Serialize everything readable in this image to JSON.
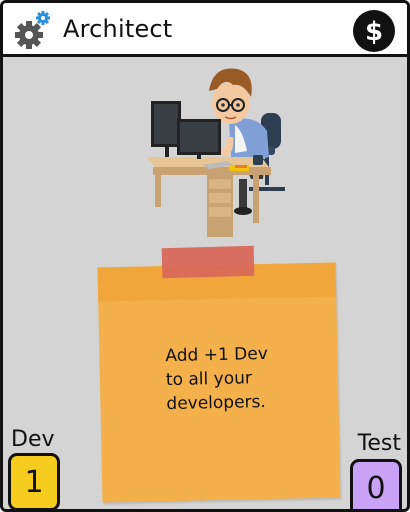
{
  "card": {
    "title": "Architect",
    "settings_icon": "gear-icon",
    "currency_icon": "dollar-icon",
    "currency_symbol": "$",
    "description_lines": [
      "Add +1 Dev",
      "to all your",
      "developers."
    ]
  },
  "stats": {
    "dev": {
      "label": "Dev",
      "value": "1"
    },
    "test": {
      "label": "Test",
      "value": "0"
    }
  },
  "colors": {
    "background": "#d4d4d4",
    "note": "#f4b04a",
    "tape": "#d8695a",
    "dev_box": "#f6cc1e",
    "test_box": "#c9a1f7",
    "gear_accent": "#2a8fd8"
  }
}
